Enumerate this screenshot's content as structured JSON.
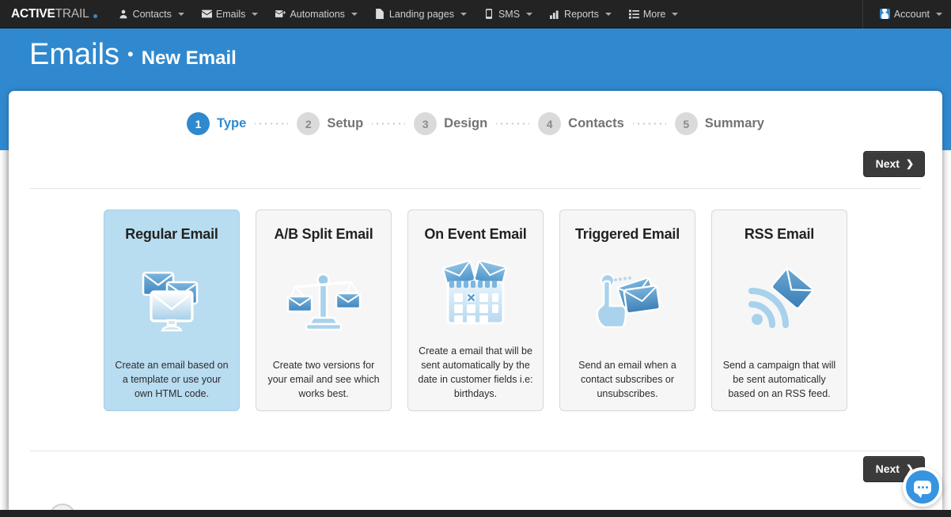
{
  "topnav": {
    "brand": {
      "part1": "ACTIVE",
      "part2": "TRAIL",
      "dot_color": "#3089ce"
    },
    "items": [
      {
        "label": "Contacts",
        "icon": "person-icon",
        "has_caret": true
      },
      {
        "label": "Emails",
        "icon": "envelope-icon",
        "has_caret": true
      },
      {
        "label": "Automations",
        "icon": "envelope-plus-icon",
        "has_caret": true
      },
      {
        "label": "Landing pages",
        "icon": "page-icon",
        "has_caret": true
      },
      {
        "label": "SMS",
        "icon": "mobile-icon",
        "has_caret": true
      },
      {
        "label": "Reports",
        "icon": "bar-chart-icon",
        "has_caret": true
      },
      {
        "label": "More",
        "icon": "list-icon",
        "has_caret": true
      }
    ],
    "account": {
      "label": "Account",
      "icon": "user-avatar-icon",
      "has_caret": true
    }
  },
  "pagehead": {
    "title": "Emails",
    "separator": "•",
    "subtitle": "New Email",
    "background": "#3089ce"
  },
  "steps": [
    {
      "number": "1",
      "label": "Type",
      "active": true
    },
    {
      "number": "2",
      "label": "Setup",
      "active": false
    },
    {
      "number": "3",
      "label": "Design",
      "active": false
    },
    {
      "number": "4",
      "label": "Contacts",
      "active": false
    },
    {
      "number": "5",
      "label": "Summary",
      "active": false
    }
  ],
  "buttons": {
    "next_top": {
      "label": "Next",
      "chevron": "❯"
    },
    "next_bottom": {
      "label": "Next",
      "chevron": "❯"
    }
  },
  "cards": [
    {
      "title": "Regular Email",
      "description": "Create an email based on a template or use your own HTML code.",
      "icon": "monitor-envelopes-icon",
      "selected": true
    },
    {
      "title": "A/B Split Email",
      "description": "Create two versions for your email and see which works best.",
      "icon": "balance-scale-envelopes-icon",
      "selected": false
    },
    {
      "title": "On Event Email",
      "description": "Create a email that will be sent automatically by the date in customer fields i.e: birthdays.",
      "icon": "calendar-envelopes-icon",
      "selected": false
    },
    {
      "title": "Triggered Email",
      "description": "Send an email when a contact subscribes or unsubscribes.",
      "icon": "hand-click-envelopes-icon",
      "selected": false
    },
    {
      "title": "RSS Email",
      "description": "Send a campaign that will be sent automatically based on an RSS feed.",
      "icon": "rss-envelope-icon",
      "selected": false
    }
  ],
  "chat": {
    "icon": "chat-bubble-icon",
    "accent": "#3694e0"
  }
}
